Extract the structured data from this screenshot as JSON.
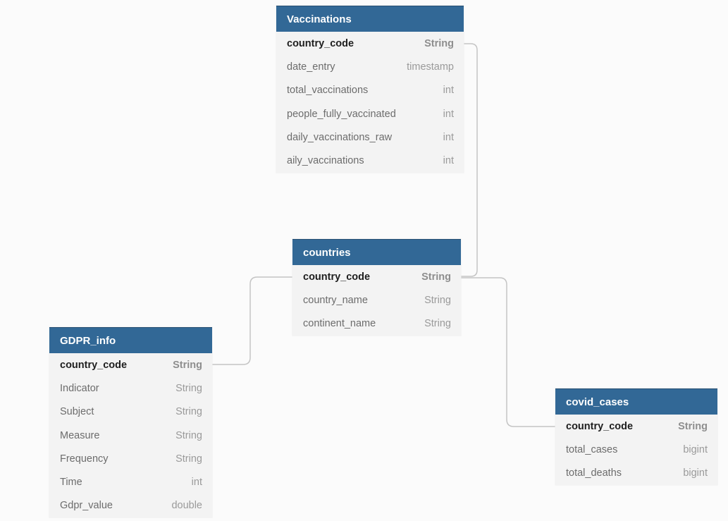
{
  "entities": {
    "vaccinations": {
      "title": "Vaccinations",
      "fields": [
        {
          "name": "country_code",
          "type": "String",
          "primary": true
        },
        {
          "name": "date_entry",
          "type": "timestamp",
          "primary": false
        },
        {
          "name": "total_vaccinations",
          "type": "int",
          "primary": false
        },
        {
          "name": "people_fully_vaccinated",
          "type": "int",
          "primary": false
        },
        {
          "name": "daily_vaccinations_raw",
          "type": "int",
          "primary": false
        },
        {
          "name": "aily_vaccinations",
          "type": "int",
          "primary": false
        }
      ]
    },
    "countries": {
      "title": "countries",
      "fields": [
        {
          "name": "country_code",
          "type": "String",
          "primary": true
        },
        {
          "name": "country_name",
          "type": "String",
          "primary": false
        },
        {
          "name": "continent_name",
          "type": "String",
          "primary": false
        }
      ]
    },
    "gdpr_info": {
      "title": "GDPR_info",
      "fields": [
        {
          "name": "country_code",
          "type": "String",
          "primary": true
        },
        {
          "name": "Indicator",
          "type": "String",
          "primary": false
        },
        {
          "name": "Subject",
          "type": "String",
          "primary": false
        },
        {
          "name": "Measure",
          "type": "String",
          "primary": false
        },
        {
          "name": "Frequency",
          "type": "String",
          "primary": false
        },
        {
          "name": "Time",
          "type": "int",
          "primary": false
        },
        {
          "name": "Gdpr_value",
          "type": "double",
          "primary": false
        }
      ]
    },
    "covid_cases": {
      "title": "covid_cases",
      "fields": [
        {
          "name": "country_code",
          "type": "String",
          "primary": true
        },
        {
          "name": "total_cases",
          "type": "bigint",
          "primary": false
        },
        {
          "name": "total_deaths",
          "type": "bigint",
          "primary": false
        }
      ]
    }
  },
  "theme": {
    "header_color": "#326896",
    "connector_color": "#c4c4c4"
  }
}
